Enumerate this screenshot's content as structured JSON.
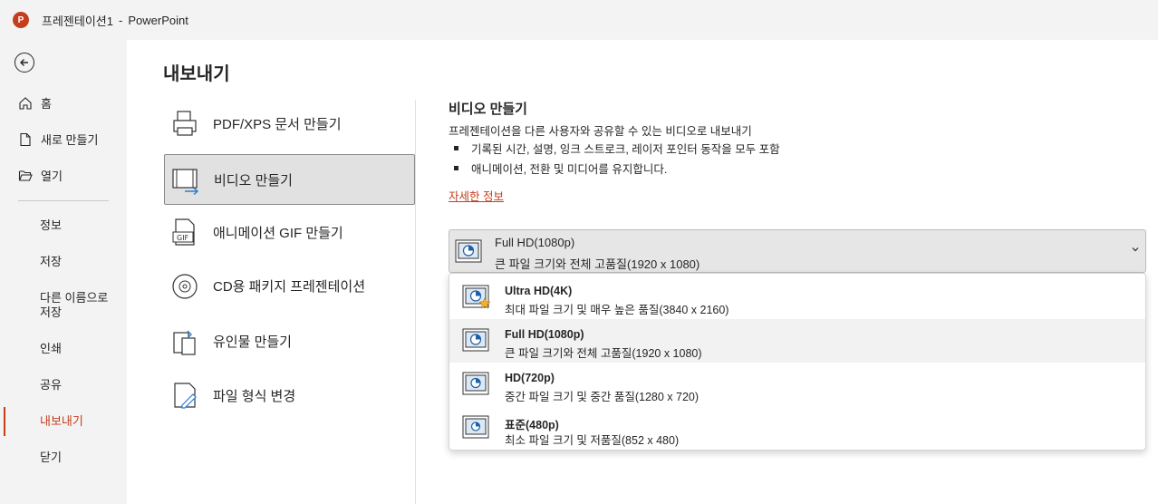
{
  "titlebar": {
    "app_icon": "P",
    "doc_name": "프레젠테이션1",
    "separator": "-",
    "app_name": "PowerPoint"
  },
  "nav": {
    "back_icon": "back-arrow-icon",
    "items": [
      {
        "label": "홈",
        "icon": "home-icon"
      },
      {
        "label": "새로 만들기",
        "icon": "new-file-icon"
      },
      {
        "label": "열기",
        "icon": "open-folder-icon"
      }
    ],
    "sub_items": [
      "정보",
      "저장",
      "다른 이름으로 저장",
      "인쇄",
      "공유",
      "내보내기",
      "닫기"
    ],
    "active": "내보내기",
    "accent_color": "#c43e1c"
  },
  "main": {
    "title": "내보내기",
    "options": [
      {
        "label": "PDF/XPS 문서 만들기",
        "icon": "pdf-xps-icon"
      },
      {
        "label": "비디오 만들기",
        "icon": "video-icon",
        "selected": true
      },
      {
        "label": "애니메이션 GIF 만들기",
        "icon": "gif-icon"
      },
      {
        "label": "CD용 패키지 프레젠테이션",
        "icon": "cd-icon"
      },
      {
        "label": "유인물 만들기",
        "icon": "handout-icon"
      },
      {
        "label": "파일 형식 변경",
        "icon": "change-format-icon"
      }
    ],
    "section": {
      "title": "비디오 만들기",
      "description": "프레젠테이션을 다른 사용자와 공유할 수 있는 비디오로 내보내기",
      "bullets": [
        "기록된 시간, 설명, 잉크 스트로크, 레이저 포인터 동작을 모두 포함",
        "애니메이션, 전환 및 미디어를 유지합니다."
      ],
      "more_link": "자세한 정보"
    },
    "quality_dropdown": {
      "selected_title": "Full HD(1080p)",
      "selected_sub": "큰 파일 크기와 전체 고품질(1920 x 1080)",
      "options": [
        {
          "title": "Ultra HD(4K)",
          "sub": "최대 파일 크기 및 매우 높은 품질(3840 x 2160)",
          "icon": "ultra-hd-icon"
        },
        {
          "title": "Full HD(1080p)",
          "sub": "큰 파일 크기와 전체 고품질(1920 x 1080)",
          "icon": "full-hd-icon",
          "highlighted": true
        },
        {
          "title": "HD(720p)",
          "sub": "중간 파일 크기 및 중간 품질(1280 x 720)",
          "icon": "hd-icon"
        },
        {
          "title": "표준(480p)",
          "sub": "최소 파일 크기 및 저품질(852 x 480)",
          "icon": "standard-icon"
        }
      ]
    }
  }
}
